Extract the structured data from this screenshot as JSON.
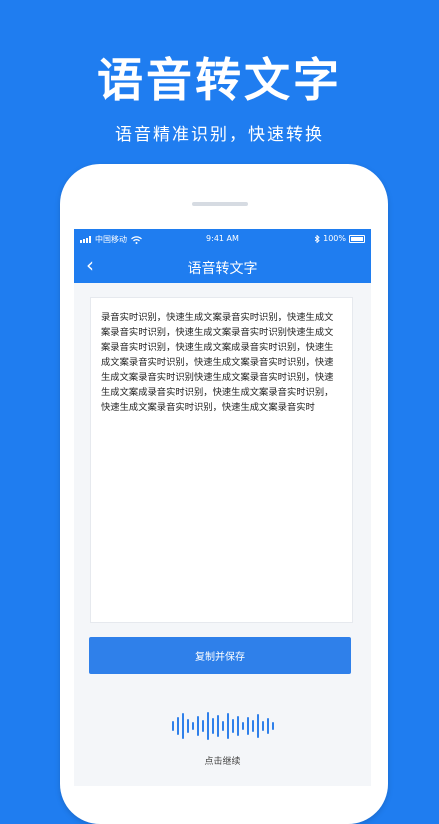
{
  "hero": {
    "title": "语音转文字",
    "subtitle": "语音精准识别，快速转换"
  },
  "status_bar": {
    "carrier": "中国移动",
    "time": "9:41 AM",
    "battery": "100%"
  },
  "nav": {
    "title": "语音转文字",
    "back_icon": "chevron-left-icon"
  },
  "transcript": {
    "text": "录音实时识别，快速生成文案录音实时识别，快速生成文案录音实时识别，快速生成文案录音实时识别快速生成文案录音实时识别，快速生成文案成录音实时识别，快速生成文案录音实时识别，快速生成文案录音实时识别，快速生成文案录音实时识别快速生成文案录音实时识别，快速生成文案成录音实时识别，快速生成文案录音实时识别，快速生成文案录音实时识别，快速生成文案录音实时"
  },
  "actions": {
    "copy_save_label": "复制并保存",
    "continue_label": "点击继续"
  },
  "colors": {
    "brand_blue": "#1f7df0",
    "button_blue": "#2f80ea"
  }
}
